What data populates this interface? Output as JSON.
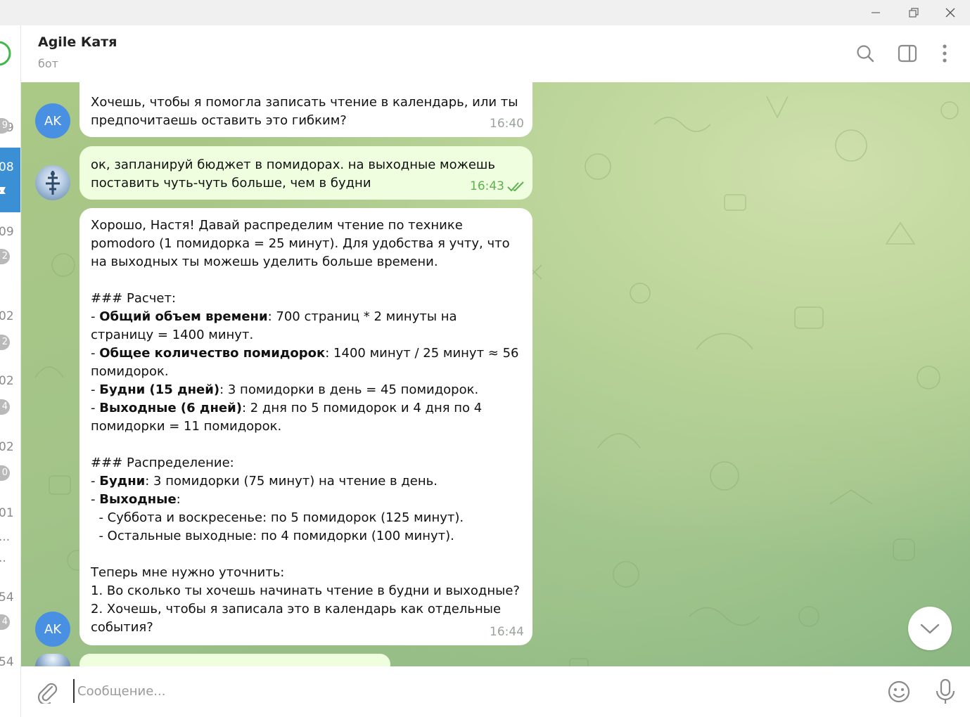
{
  "window": {
    "minimize_icon": "minimize-icon",
    "restore_icon": "restore-icon",
    "close_icon": "close-icon"
  },
  "left_list": {
    "numbers": [
      "09",
      "08",
      "09",
      "02",
      "02",
      "02",
      "01",
      "...",
      "..",
      "54",
      "54"
    ],
    "badges": [
      "9",
      "2",
      "2",
      "4",
      "0",
      "4"
    ]
  },
  "header": {
    "title": "Agile Катя",
    "subtitle": "бот",
    "icons": [
      "search-icon",
      "sidebar-toggle-icon",
      "more-vertical-icon"
    ]
  },
  "messages": [
    {
      "direction": "in",
      "avatar": "AK",
      "text": "Хочешь, чтобы я помогла записать чтение в календарь, или ты предпочитаешь оставить это гибким?",
      "time": "16:40"
    },
    {
      "direction": "out",
      "text": "ок, запланируй бюджет в помидорах. на выходные можешь поставить чуть-чуть больше, чем в будни",
      "time": "16:43",
      "status": "read"
    },
    {
      "direction": "in",
      "avatar": "AK",
      "time": "16:44",
      "lines": [
        "Хорошо, Настя! Давай распределим чтение по технике pomodoro (1 помидорка = 25 минут). Для удобства я учту, что на выходных ты можешь уделить больше времени.",
        "",
        "### Расчет:",
        "- **Общий объем времени**: 700 страниц * 2 минуты на страницу = 1400 минут.",
        "- **Общее количество помидорок**: 1400 минут / 25 минут ≈ 56 помидорок.",
        "- **Будни (15 дней)**: 3 помидорки в день = 45 помидорок.",
        "- **Выходные (6 дней)**: 2 дня по 5 помидорок и 4 дня по 4 помидорки = 11 помидорок.",
        "",
        "### Распределение:",
        "- **Будни**: 3 помидорки (75 минут) на чтение в день.",
        "- **Выходные**:",
        "  - Суббота и воскресенье: по 5 помидорок (125 минут).",
        "  - Остальные выходные: по 4 помидорки (100 минут).",
        "",
        "Теперь мне нужно уточнить:",
        "1. Во сколько ты хочешь начинать чтение в будни и выходные?",
        "2. Хочешь, чтобы я записала это в календарь как отдельные события?"
      ]
    }
  ],
  "composer": {
    "placeholder": "Сообщение...",
    "value": "",
    "icons": [
      "attach-icon",
      "emoji-icon",
      "microphone-icon"
    ]
  }
}
